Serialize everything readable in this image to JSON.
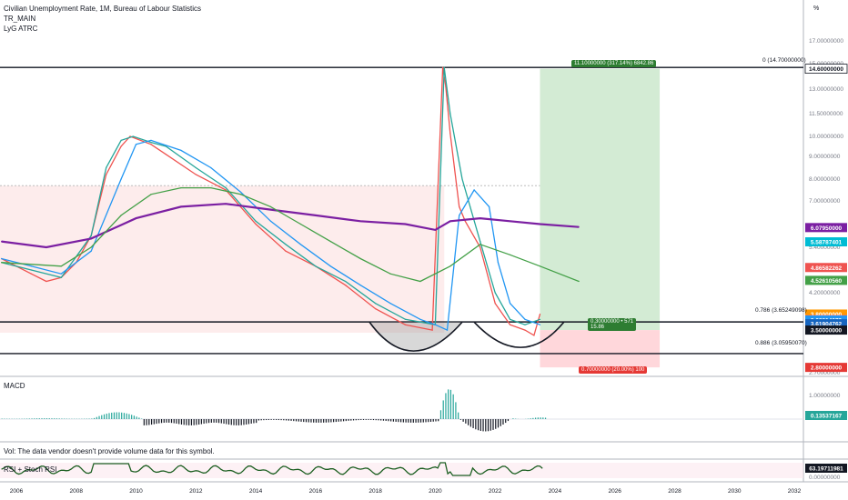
{
  "header": {
    "title": "Civilian Unemployment Rate, 1M, Bureau of Labour Statistics",
    "indicator_1": "TR_MAIN",
    "indicator_2": "LyG ATRC",
    "unit_label": "%"
  },
  "panes": {
    "macd_label": "MACD",
    "volume_note": "Vol: The data vendor doesn't provide volume data for this symbol.",
    "rsi_label": "RSI + Stoch RSI"
  },
  "position": {
    "target_label": "11.10000000 (317.14%) 6842.86",
    "entry_label_1": "0.30000000 • 571",
    "entry_label_2": "15.86",
    "stop_label": "0.70000000 (20.00%) 100"
  },
  "fib": {
    "level_0": "0 (14.70000000)",
    "level_786": "0.786 (3.65249098)",
    "level_886": "0.886 (3.05950070)"
  },
  "colors": {
    "up": "#26a69a",
    "price": "#ef5350",
    "ma_purple": "#7b1fa2",
    "ma_blue": "#2196f3",
    "target_fill": "#c8e6c9",
    "stop_fill": "#ffcdd2",
    "macd_pos": "#26a69a",
    "macd_neg": "#131722"
  },
  "chart_data": {
    "type": "line",
    "title": "Civilian Unemployment Rate, 1M, Bureau of Labour Statistics",
    "x_ticks": [
      "2006",
      "2008",
      "2010",
      "2012",
      "2014",
      "2016",
      "2018",
      "2020",
      "2022",
      "2024",
      "2026",
      "2028",
      "2030",
      "2032"
    ],
    "y_ticks": [
      "17.00000000",
      "15.00000000",
      "13.00000000",
      "11.50000000",
      "10.00000000",
      "9.00000000",
      "8.00000000",
      "7.00000000",
      "5.40000000",
      "4.20000000",
      "2.70000000"
    ],
    "macd_ticks": [
      "1.00000000",
      "0.00000000"
    ],
    "rsi_ticks": [
      "0.00000000"
    ],
    "series": [
      {
        "color": "#ef5350",
        "x": [
          2005.5,
          2006.5,
          2007.0,
          2007.5,
          2008.0,
          2008.5,
          2009.0,
          2009.5,
          2009.8,
          2010.5,
          2011.0,
          2012.0,
          2013.0,
          2014.0,
          2015.0,
          2016.0,
          2017.0,
          2018.0,
          2019.0,
          2019.9,
          2020.25,
          2020.35,
          2020.5,
          2020.8,
          2021.0,
          2021.5,
          2022.0,
          2022.5,
          2023.0,
          2023.3,
          2023.5
        ],
        "values": [
          5.1,
          4.7,
          4.5,
          4.6,
          5.0,
          5.8,
          8.2,
          9.5,
          10.0,
          9.6,
          9.1,
          8.2,
          7.5,
          6.2,
          5.3,
          4.9,
          4.4,
          3.9,
          3.6,
          3.5,
          14.7,
          13.2,
          10.2,
          6.8,
          6.3,
          5.4,
          4.0,
          3.6,
          3.5,
          3.4,
          3.8
        ]
      },
      {
        "color": "#26a69a",
        "x": [
          2005.5,
          2006.5,
          2007.5,
          2008.5,
          2009.0,
          2009.5,
          2009.9,
          2010.5,
          2011.0,
          2012.0,
          2013.0,
          2014.0,
          2015.0,
          2016.0,
          2017.0,
          2018.0,
          2019.0,
          2020.0,
          2020.3,
          2020.5,
          2020.9,
          2021.5,
          2022.0,
          2022.5,
          2023.0,
          2023.5
        ],
        "values": [
          5.0,
          4.8,
          4.6,
          5.8,
          8.5,
          9.8,
          10.0,
          9.7,
          9.5,
          8.5,
          7.6,
          6.3,
          5.5,
          4.9,
          4.5,
          4.0,
          3.7,
          3.6,
          14.7,
          11.5,
          8.0,
          5.6,
          4.2,
          3.7,
          3.6,
          3.7
        ]
      },
      {
        "color": "#2196f3",
        "x": [
          2005.5,
          2006.5,
          2007.5,
          2008.5,
          2009.5,
          2010.0,
          2010.5,
          2011.5,
          2012.5,
          2013.5,
          2014.5,
          2015.5,
          2016.5,
          2017.5,
          2018.5,
          2019.5,
          2020.0,
          2020.4,
          2020.8,
          2021.3,
          2021.8,
          2022.1,
          2022.5,
          2023.0,
          2023.5
        ],
        "values": [
          5.1,
          4.9,
          4.7,
          5.3,
          8.0,
          9.6,
          9.8,
          9.3,
          8.5,
          7.4,
          6.3,
          5.5,
          4.9,
          4.4,
          4.0,
          3.7,
          3.6,
          3.5,
          6.5,
          7.5,
          6.8,
          5.0,
          4.0,
          3.7,
          3.6
        ]
      },
      {
        "color": "#7b1fa2",
        "x": [
          2005.5,
          2007.0,
          2008.5,
          2010.0,
          2011.5,
          2013.0,
          2014.5,
          2016.0,
          2017.5,
          2019.0,
          2020.0,
          2020.5,
          2021.5,
          2022.5,
          2023.5,
          2024.8
        ],
        "values": [
          5.6,
          5.4,
          5.7,
          6.4,
          6.8,
          6.9,
          6.7,
          6.5,
          6.3,
          6.2,
          6.0,
          6.3,
          6.4,
          6.3,
          6.2,
          6.1
        ]
      },
      {
        "color": "#43a047",
        "x": [
          2005.5,
          2007.5,
          2008.5,
          2009.5,
          2010.5,
          2011.5,
          2012.5,
          2013.5,
          2014.5,
          2015.5,
          2016.5,
          2017.5,
          2018.5,
          2019.5,
          2020.5,
          2021.5,
          2022.5,
          2023.5,
          2024.8
        ],
        "values": [
          5.0,
          4.9,
          5.4,
          6.5,
          7.3,
          7.6,
          7.6,
          7.3,
          6.8,
          6.2,
          5.6,
          5.1,
          4.7,
          4.5,
          4.9,
          5.5,
          5.2,
          4.9,
          4.5
        ]
      }
    ],
    "fib_levels": [
      {
        "label": "0",
        "value": 14.7
      },
      {
        "label": "0.786",
        "value": 3.65249098
      },
      {
        "label": "0.886",
        "value": 3.0595007
      }
    ],
    "price_tags": [
      {
        "value": 14.6,
        "label": "14.60000000",
        "bg": "#ffffff",
        "fg": "#131722",
        "border": "#131722"
      },
      {
        "value": 6.0795,
        "label": "6.07950000",
        "bg": "#7b1fa2",
        "fg": "#ffffff"
      },
      {
        "value": 5.58787401,
        "label": "5.58787401",
        "bg": "#00bcd4",
        "fg": "#ffffff"
      },
      {
        "value": 4.86582262,
        "label": "4.86582262",
        "bg": "#ef5350",
        "fg": "#ffffff"
      },
      {
        "value": 4.5261056,
        "label": "4.52610560",
        "bg": "#43a047",
        "fg": "#ffffff"
      },
      {
        "value": 3.8,
        "label": "3.80000000",
        "bg": "#ff9800",
        "fg": "#ffffff"
      },
      {
        "value": 3.69227559,
        "label": "3.69227559",
        "bg": "#e040fb",
        "fg": "#ffffff"
      },
      {
        "value": 3.6881407,
        "label": "3.68814070",
        "bg": "#2196f3",
        "fg": "#ffffff"
      },
      {
        "value": 3.61904762,
        "label": "3.61904762",
        "bg": "#1565c0",
        "fg": "#ffffff"
      },
      {
        "value": 3.5,
        "label": "3.50000000",
        "bg": "#131722",
        "fg": "#ffffff"
      },
      {
        "value": 2.8,
        "label": "2.80000000",
        "bg": "#e53935",
        "fg": "#ffffff"
      }
    ],
    "macd_value_tag": "0.13537167",
    "rsi_value_tag": "63.19711981",
    "position_box": {
      "x_start": 2023.5,
      "x_end": 2027.5,
      "entry": 3.5,
      "target": 14.6,
      "stop": 2.8
    }
  }
}
